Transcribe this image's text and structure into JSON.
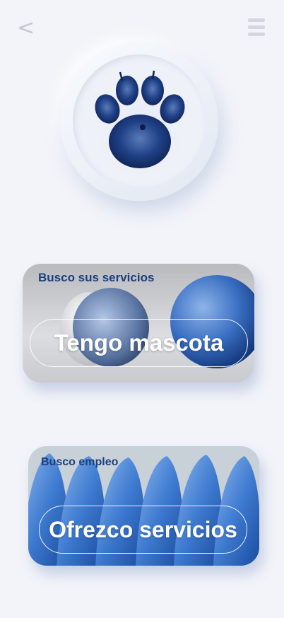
{
  "header": {
    "back_icon": "chevron-left-icon",
    "back_glyph": "<",
    "menu_icon": "hamburger-menu-icon"
  },
  "logo": {
    "icon": "paw-icon",
    "accent": "#1e4fa3"
  },
  "cards": [
    {
      "subtitle": "Busco sus servicios",
      "label": "Tengo mascota"
    },
    {
      "subtitle": "Busco empleo",
      "label": "Ofrezco servicios"
    }
  ],
  "colors": {
    "background": "#f2f4f9",
    "subtitle": "#1b3f7e",
    "brand_blue": "#2b63b5"
  }
}
